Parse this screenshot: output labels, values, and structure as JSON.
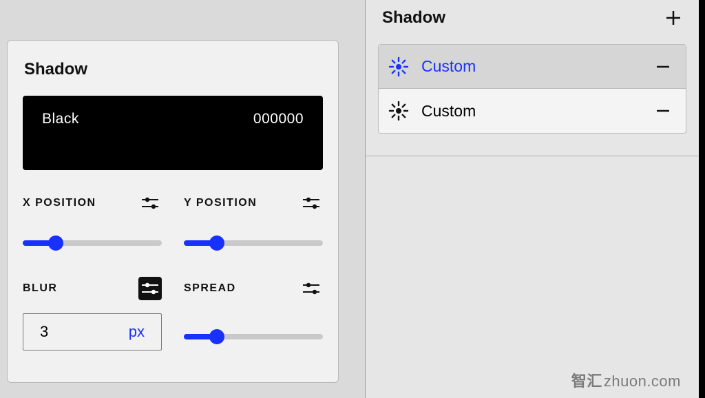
{
  "leftPanel": {
    "title": "Shadow",
    "color": {
      "name": "Black",
      "hex": "000000"
    },
    "controls": {
      "xpos": {
        "label": "X POSITION",
        "toggleActive": false,
        "sliderPercent": 24
      },
      "ypos": {
        "label": "Y POSITION",
        "toggleActive": false,
        "sliderPercent": 24
      },
      "blur": {
        "label": "BLUR",
        "toggleActive": true,
        "value": "3",
        "unit": "px"
      },
      "spread": {
        "label": "SPREAD",
        "toggleActive": false,
        "sliderPercent": 24
      }
    }
  },
  "rightPanel": {
    "title": "Shadow",
    "items": [
      {
        "label": "Custom",
        "active": true
      },
      {
        "label": "Custom",
        "active": false
      }
    ]
  },
  "colors": {
    "accent": "#1931ff"
  },
  "watermark": {
    "zh": "智汇",
    "en": "zhuon.com"
  }
}
